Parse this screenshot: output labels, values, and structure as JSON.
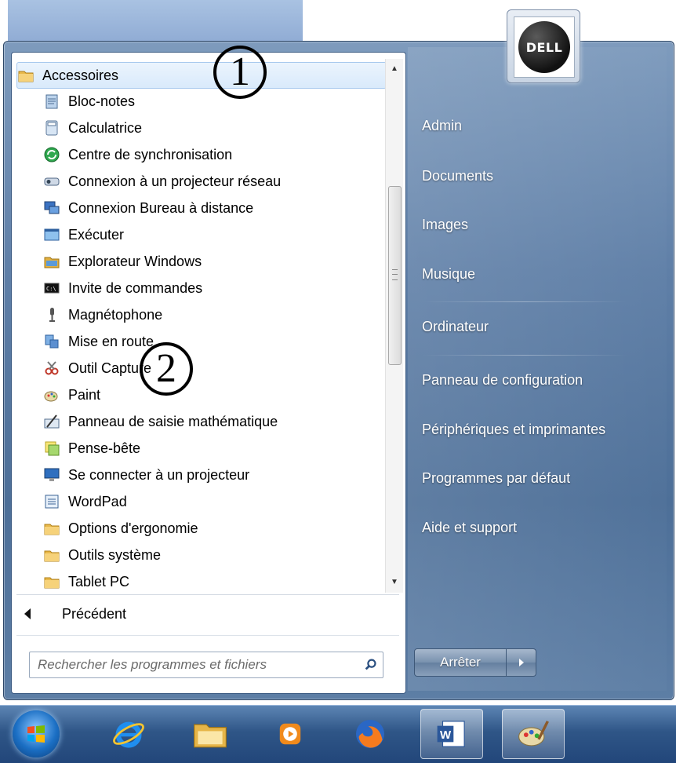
{
  "programs": {
    "items": [
      {
        "label": "Accessoires",
        "icon": "folder-icon",
        "selected": true
      },
      {
        "label": "Bloc-notes",
        "icon": "notepad-icon"
      },
      {
        "label": "Calculatrice",
        "icon": "calculator-icon"
      },
      {
        "label": "Centre de synchronisation",
        "icon": "sync-center-icon"
      },
      {
        "label": "Connexion à un projecteur réseau",
        "icon": "network-projector-icon"
      },
      {
        "label": "Connexion Bureau à distance",
        "icon": "remote-desktop-icon"
      },
      {
        "label": "Exécuter",
        "icon": "run-icon"
      },
      {
        "label": "Explorateur Windows",
        "icon": "explorer-icon"
      },
      {
        "label": "Invite de commandes",
        "icon": "command-prompt-icon"
      },
      {
        "label": "Magnétophone",
        "icon": "microphone-icon"
      },
      {
        "label": "Mise en route",
        "icon": "getting-started-icon"
      },
      {
        "label": "Outil Capture",
        "icon": "snipping-tool-icon"
      },
      {
        "label": "Paint",
        "icon": "paint-icon"
      },
      {
        "label": "Panneau de saisie mathématique",
        "icon": "math-input-icon"
      },
      {
        "label": "Pense-bête",
        "icon": "sticky-notes-icon"
      },
      {
        "label": "Se connecter à un projecteur",
        "icon": "projector-icon"
      },
      {
        "label": "WordPad",
        "icon": "wordpad-icon"
      },
      {
        "label": "Options d'ergonomie",
        "icon": "folder-icon"
      },
      {
        "label": "Outils système",
        "icon": "folder-icon"
      },
      {
        "label": "Tablet PC",
        "icon": "folder-icon"
      }
    ],
    "back_label": "Précédent"
  },
  "search": {
    "placeholder": "Rechercher les programmes et fichiers",
    "icon": "search-icon"
  },
  "right_pane": {
    "links": [
      "Admin",
      "Documents",
      "Images",
      "Musique",
      "Ordinateur",
      "Panneau de configuration",
      "Périphériques et imprimantes",
      "Programmes par défaut",
      "Aide et support"
    ],
    "shutdown_label": "Arrêter"
  },
  "avatar": {
    "logo_text": "DELL"
  },
  "annotations": {
    "first": "1",
    "second": "2"
  },
  "taskbar": {
    "items": [
      "start-orb-icon",
      "internet-explorer-icon",
      "file-explorer-icon",
      "media-player-icon",
      "firefox-icon",
      "word-icon",
      "paint-icon"
    ]
  },
  "colors": {
    "menu_blue": "#5f7fa7",
    "taskbar_blue": "#2f5687",
    "selection": "#d9eafb"
  }
}
